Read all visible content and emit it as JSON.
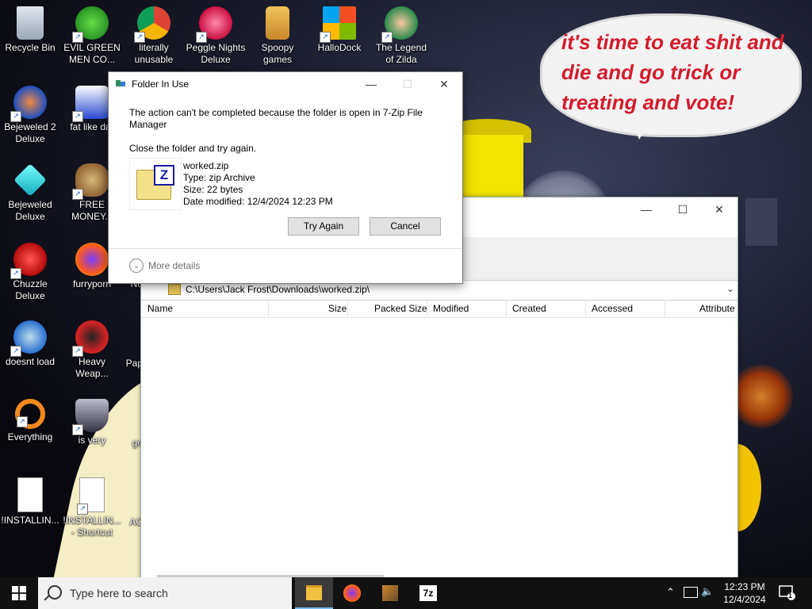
{
  "wallpaper": {
    "bubble_text": "it's time to eat shit and die and go trick or treating and vote!"
  },
  "desktop_icons": [
    {
      "label": "Recycle Bin",
      "icon": "recycle-bin-icon"
    },
    {
      "label": "EVIL GREEN MEN CO...",
      "icon": "green-men-icon"
    },
    {
      "label": "literally unusable",
      "icon": "chrome-icon"
    },
    {
      "label": "Peggle Nights Deluxe",
      "icon": "peggle-icon"
    },
    {
      "label": "Spoopy games",
      "icon": "spoopy-folder-icon"
    },
    {
      "label": "HalloDock",
      "icon": "windows-logo-icon"
    },
    {
      "label": "The Legend of Zilda",
      "icon": "zilda-icon"
    },
    {
      "label": "Bejeweled 2 Deluxe",
      "icon": "bejeweled2-icon"
    },
    {
      "label": "fat like dar",
      "icon": "mp-icon"
    },
    {
      "label": "Bejeweled Deluxe",
      "icon": "diamond-icon"
    },
    {
      "label": "FREE MONEY.c",
      "icon": "money-bag-icon"
    },
    {
      "label": "Chuzzle Deluxe",
      "icon": "chuzzle-icon"
    },
    {
      "label": "furryporn",
      "icon": "firefox-icon"
    },
    {
      "label": "No",
      "icon": "partial-icon"
    },
    {
      "label": "doesnt load",
      "icon": "thunderbird-icon"
    },
    {
      "label": "Heavy Weap...",
      "icon": "radiation-icon"
    },
    {
      "label": "Pap",
      "icon": "partial-icon"
    },
    {
      "label": "Everything",
      "icon": "everything-search-icon"
    },
    {
      "label": "is very",
      "icon": "shield-icon"
    },
    {
      "label": "ge",
      "icon": "partial-icon"
    },
    {
      "label": "!INSTALLIN...",
      "icon": "text-file-icon"
    },
    {
      "label": "!INSTALLIN... - Shortcut",
      "icon": "text-file-icon"
    },
    {
      "label": "AC",
      "icon": "partial-icon"
    }
  ],
  "zip_window": {
    "path": "C:\\Users\\Jack Frost\\Downloads\\worked.zip\\",
    "columns": [
      "Name",
      "Size",
      "Packed Size",
      "Modified",
      "Created",
      "Accessed",
      "Attribute"
    ]
  },
  "dialog": {
    "title": "Folder In Use",
    "message": "The action can't be completed because the folder is open in 7-Zip File Manager",
    "subtext": "Close the folder and try again.",
    "file": {
      "name": "worked.zip",
      "type": "Type: zip Archive",
      "size": "Size: 22 bytes",
      "modified": "Date modified: 12/4/2024 12:23 PM"
    },
    "try_again_label": "Try Again",
    "cancel_label": "Cancel",
    "more_details_label": "More details"
  },
  "taskbar": {
    "search_placeholder": "Type here to search",
    "clock_time": "12:23 PM",
    "clock_date": "12/4/2024",
    "notification_count": "1"
  },
  "colors": {
    "taskbar": "#111111",
    "accent": "#76b9ed",
    "bubble_text": "#d31c2c"
  }
}
